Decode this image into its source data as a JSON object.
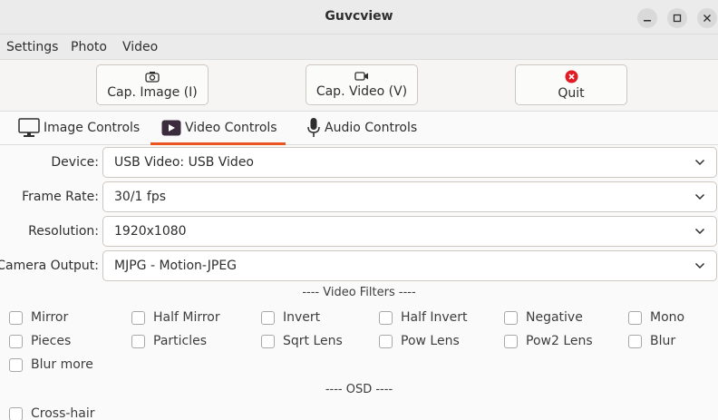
{
  "window": {
    "title": "Guvcview"
  },
  "menubar": [
    "Settings",
    "Photo",
    "Video"
  ],
  "toolbar": {
    "capture_image": "Cap. Image (I)",
    "capture_video": "Cap. Video (V)",
    "quit": "Quit"
  },
  "tabs": [
    "Image Controls",
    "Video Controls",
    "Audio Controls"
  ],
  "active_tab": "Video Controls",
  "fields": {
    "device": {
      "label": "Device:",
      "value": "USB Video: USB Video"
    },
    "frame_rate": {
      "label": "Frame Rate:",
      "value": "30/1 fps"
    },
    "resolution": {
      "label": "Resolution:",
      "value": "1920x1080"
    },
    "camera_output": {
      "label": "Camera Output:",
      "value": "MJPG - Motion-JPEG"
    }
  },
  "video_filters": {
    "heading": "---- Video Filters ----",
    "items": [
      {
        "label": "Mirror",
        "checked": false
      },
      {
        "label": "Half Mirror",
        "checked": false
      },
      {
        "label": "Invert",
        "checked": false
      },
      {
        "label": "Half Invert",
        "checked": false
      },
      {
        "label": "Negative",
        "checked": false
      },
      {
        "label": "Mono",
        "checked": false
      },
      {
        "label": "Pieces",
        "checked": false
      },
      {
        "label": "Particles",
        "checked": false
      },
      {
        "label": "Sqrt Lens",
        "checked": false
      },
      {
        "label": "Pow Lens",
        "checked": false
      },
      {
        "label": "Pow2 Lens",
        "checked": false
      },
      {
        "label": "Blur",
        "checked": false
      },
      {
        "label": "Blur more",
        "checked": false
      }
    ]
  },
  "osd": {
    "heading": "---- OSD ----",
    "items": [
      {
        "label": "Cross-hair",
        "checked": false
      }
    ]
  },
  "colors": {
    "accent": "#e95420",
    "quit_red": "#e01b24"
  }
}
